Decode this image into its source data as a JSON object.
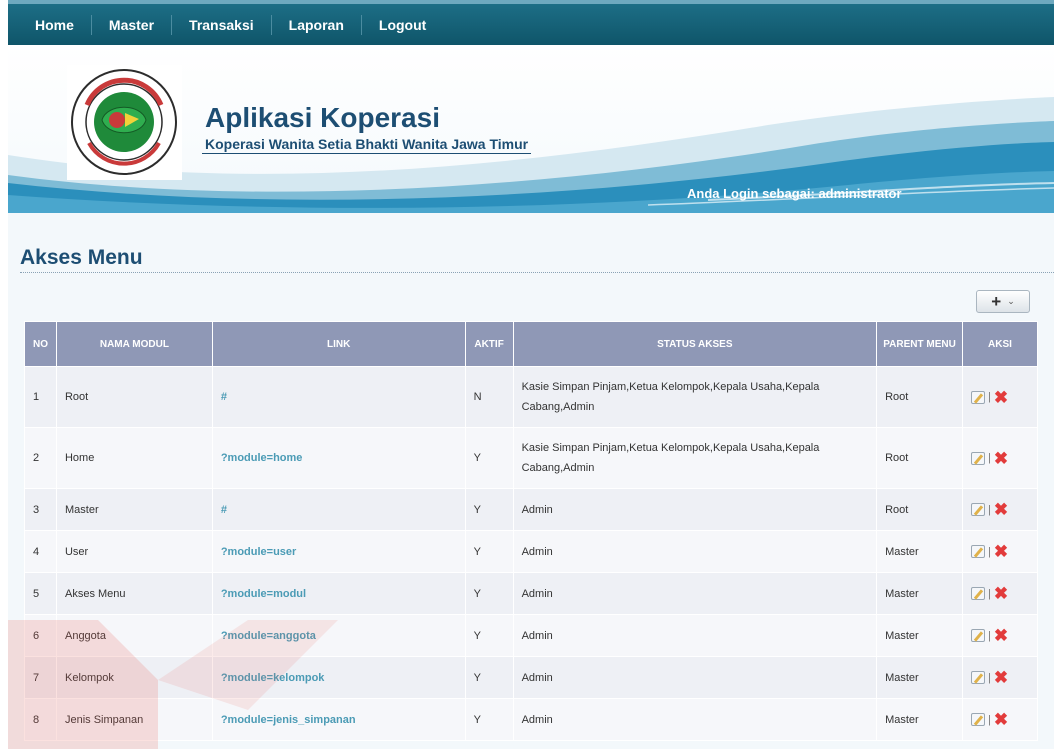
{
  "nav": [
    "Home",
    "Master",
    "Transaksi",
    "Laporan",
    "Logout"
  ],
  "header": {
    "title": "Aplikasi Koperasi",
    "subtitle": "Koperasi Wanita Setia Bhakti Wanita Jawa Timur",
    "login_info": "Anda Login sebagai: administrator",
    "logo_text": "KOPERASI WANITA \"SETIA BHAKTI WANITA\" JAWA TIMUR"
  },
  "page_title": "Akses Menu",
  "add_button": {
    "label": "+",
    "caret": "⌄"
  },
  "table": {
    "headers": {
      "no": "NO",
      "nama_modul": "NAMA MODUL",
      "link": "LINK",
      "aktif": "AKTIF",
      "status_akses": "STATUS AKSES",
      "parent_menu": "PARENT MENU",
      "aksi": "AKSI"
    },
    "rows": [
      {
        "no": "1",
        "nama_modul": "Root",
        "link": "#",
        "aktif": "N",
        "status_akses": "Kasie Simpan Pinjam,Ketua Kelompok,Kepala Usaha,Kepala Cabang,Admin",
        "parent_menu": "Root"
      },
      {
        "no": "2",
        "nama_modul": "Home",
        "link": "?module=home",
        "aktif": "Y",
        "status_akses": "Kasie Simpan Pinjam,Ketua Kelompok,Kepala Usaha,Kepala Cabang,Admin",
        "parent_menu": "Root"
      },
      {
        "no": "3",
        "nama_modul": "Master",
        "link": "#",
        "aktif": "Y",
        "status_akses": "Admin",
        "parent_menu": "Root"
      },
      {
        "no": "4",
        "nama_modul": "User",
        "link": "?module=user",
        "aktif": "Y",
        "status_akses": "Admin",
        "parent_menu": "Master"
      },
      {
        "no": "5",
        "nama_modul": "Akses Menu",
        "link": "?module=modul",
        "aktif": "Y",
        "status_akses": "Admin",
        "parent_menu": "Master"
      },
      {
        "no": "6",
        "nama_modul": "Anggota",
        "link": "?module=anggota",
        "aktif": "Y",
        "status_akses": "Admin",
        "parent_menu": "Master"
      },
      {
        "no": "7",
        "nama_modul": "Kelompok",
        "link": "?module=kelompok",
        "aktif": "Y",
        "status_akses": "Admin",
        "parent_menu": "Master"
      },
      {
        "no": "8",
        "nama_modul": "Jenis Simpanan",
        "link": "?module=jenis_simpanan",
        "aktif": "Y",
        "status_akses": "Admin",
        "parent_menu": "Master"
      }
    ],
    "aksi": {
      "separator": "|",
      "delete_glyph": "✖"
    }
  },
  "icons": [
    "koperasi-logo-icon",
    "plus-icon",
    "chevron-down-icon",
    "edit-icon",
    "delete-icon"
  ],
  "colors": {
    "nav_bg": "#0f5569",
    "title": "#1d4e73",
    "table_header": "#8f98b6",
    "link": "#4b9bb5",
    "delete": "#e23b3b"
  }
}
